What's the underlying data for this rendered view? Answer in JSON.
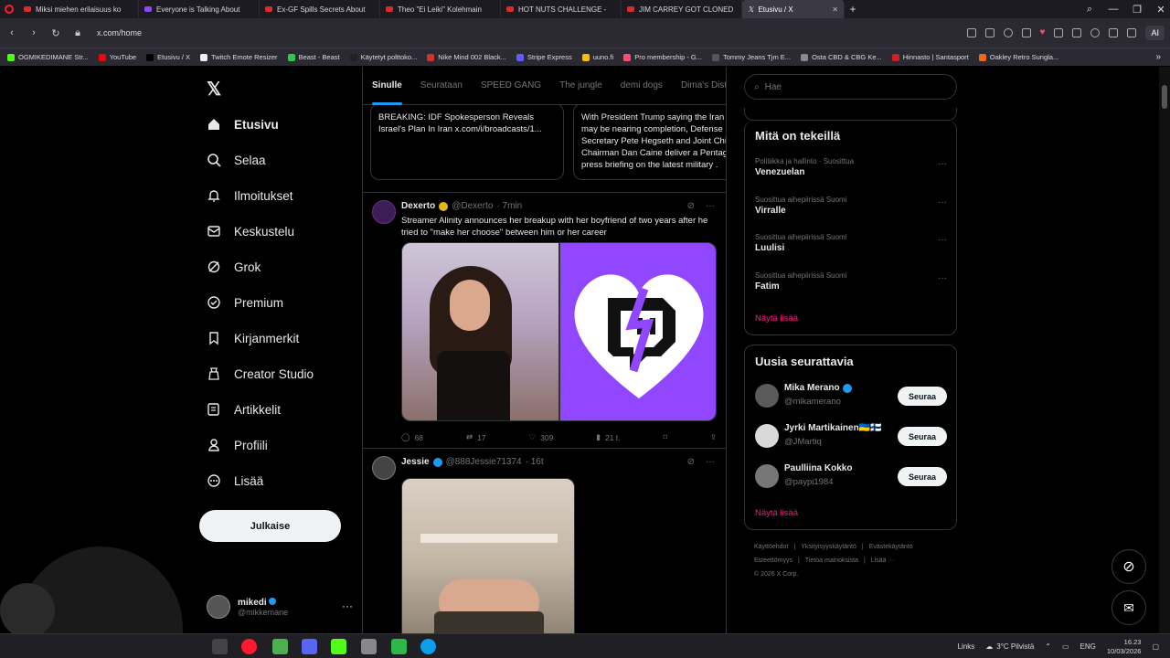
{
  "browser": {
    "tabs": [
      {
        "title": "Miksi miehen erilaisuus ko",
        "favicon": "youtube-icon"
      },
      {
        "title": "Everyone is Talking About",
        "favicon": "twitch-icon"
      },
      {
        "title": "Ex-GF Spills Secrets About",
        "favicon": "youtube-icon"
      },
      {
        "title": "Theo \"Ei Leiki\" Kolehmain",
        "favicon": "youtube-icon"
      },
      {
        "title": "HOT NUTS CHALLENGE -",
        "favicon": "youtube-icon"
      },
      {
        "title": "JIM CARREY GOT CLONED",
        "favicon": "youtube-icon"
      }
    ],
    "active_tab": {
      "title": "Etusivu / X",
      "favicon": "x-icon"
    },
    "url": "x.com/home",
    "ai_label": "AI",
    "bookmarks": [
      {
        "label": "OGMIKEDIMANE Str...",
        "color": "#53fc18"
      },
      {
        "label": "YouTube",
        "color": "#ff0000"
      },
      {
        "label": "Etusivu / X",
        "color": "#000000"
      },
      {
        "label": "Twitch Emote Resizer",
        "color": "#eeeeee"
      },
      {
        "label": "Beast - Beast",
        "color": "#2dc653"
      },
      {
        "label": "Käytetyt polttoko...",
        "color": "#222222"
      },
      {
        "label": "Nike Mind 002 Black...",
        "color": "#cc3333"
      },
      {
        "label": "Stripe Express",
        "color": "#635bff"
      },
      {
        "label": "uuno.fi",
        "color": "#f2c200"
      },
      {
        "label": "Pro membership - G...",
        "color": "#ff4d6d"
      },
      {
        "label": "Tommy Jeans Tjm E...",
        "color": "#555555"
      },
      {
        "label": "Osta CBD & CBG Ke...",
        "color": "#888888"
      },
      {
        "label": "Hinnasto | Santasport",
        "color": "#cc2222"
      },
      {
        "label": "Oakley Retro Sungla...",
        "color": "#e86a1a"
      }
    ]
  },
  "nav": {
    "items": [
      {
        "label": "Etusivu",
        "icon": "home-icon"
      },
      {
        "label": "Selaa",
        "icon": "search-icon"
      },
      {
        "label": "Ilmoitukset",
        "icon": "bell-icon"
      },
      {
        "label": "Keskustelu",
        "icon": "mail-icon"
      },
      {
        "label": "Grok",
        "icon": "grok-icon"
      },
      {
        "label": "Premium",
        "icon": "premium-icon"
      },
      {
        "label": "Kirjanmerkit",
        "icon": "bookmark-icon"
      },
      {
        "label": "Creator Studio",
        "icon": "creator-studio-icon"
      },
      {
        "label": "Artikkelit",
        "icon": "articles-icon"
      },
      {
        "label": "Profiili",
        "icon": "profile-icon"
      },
      {
        "label": "Lisää",
        "icon": "more-icon"
      }
    ],
    "post_button": "Julkaise",
    "account": {
      "name": "mikedi",
      "handle": "@mikkemane"
    }
  },
  "timeline": {
    "tabs": [
      "Sinulle",
      "Seurataan",
      "SPEED GANG",
      "The jungle",
      "demi dogs",
      "Dima's Dist"
    ],
    "cards": [
      {
        "text": "BREAKING: IDF Spokesperson Reveals Israel's Plan In Iran x.com/i/broadcasts/1..."
      },
      {
        "text": "With President Trump saying the Iran may be nearing completion, Defense Secretary Pete Hegseth and Joint Chi Chairman Dan Caine deliver a Pentag press briefing on the latest military ."
      }
    ],
    "tweets": [
      {
        "name": "Dexerto",
        "handle": "@Dexerto",
        "time": "· 7min",
        "text": "Streamer Alinity announces her breakup with her boyfriend of two years after he tried to \"make her choose\" between him or her career",
        "replies": "68",
        "retweets": "17",
        "likes": "309",
        "views": "21 t."
      },
      {
        "name": "Jessie",
        "handle": "@888Jessie71374",
        "time": "· 16t"
      }
    ]
  },
  "sidebar": {
    "search_placeholder": "Hae",
    "trends_title": "Mitä on tekeillä",
    "trends": [
      {
        "context": "Politiikka ja hallinto · Suosittua",
        "name": "Venezuelan"
      },
      {
        "context": "Suosittua aihepiirissä Suomi",
        "name": "Virralle"
      },
      {
        "context": "Suosittua aihepiirissä Suomi",
        "name": "Luulisi"
      },
      {
        "context": "Suosittua aihepiirissä Suomi",
        "name": "Fatim"
      }
    ],
    "trends_show_more": "Näytä lisää",
    "follow_title": "Uusia seurattavia",
    "follow": [
      {
        "name": "Mika Merano",
        "handle": "@mikamerano",
        "button": "Seuraa"
      },
      {
        "name": "Jyrki Martikainen🇺🇦🇫🇮",
        "handle": "@JMartiq",
        "button": "Seuraa"
      },
      {
        "name": "Paulliina Kokko",
        "handle": "@paypi1984",
        "button": "Seuraa"
      }
    ],
    "follow_show_more": "Näytä lisää",
    "footer": [
      "Käyttöehdot",
      "Yksityisyyskäytäntö",
      "Evästekäytäntö",
      "Esteettömyys",
      "Tietoa mainoksista",
      "Lisää ···",
      "© 2026 X Corp."
    ]
  },
  "taskbar": {
    "links": "Links",
    "weather": "3°C  Pilvistä",
    "lang": "ENG",
    "time": "16.23",
    "date": "10/03/2026"
  },
  "colors": {
    "accent": "#1d9bf0",
    "link": "#f91880",
    "twitch": "#9146ff"
  }
}
